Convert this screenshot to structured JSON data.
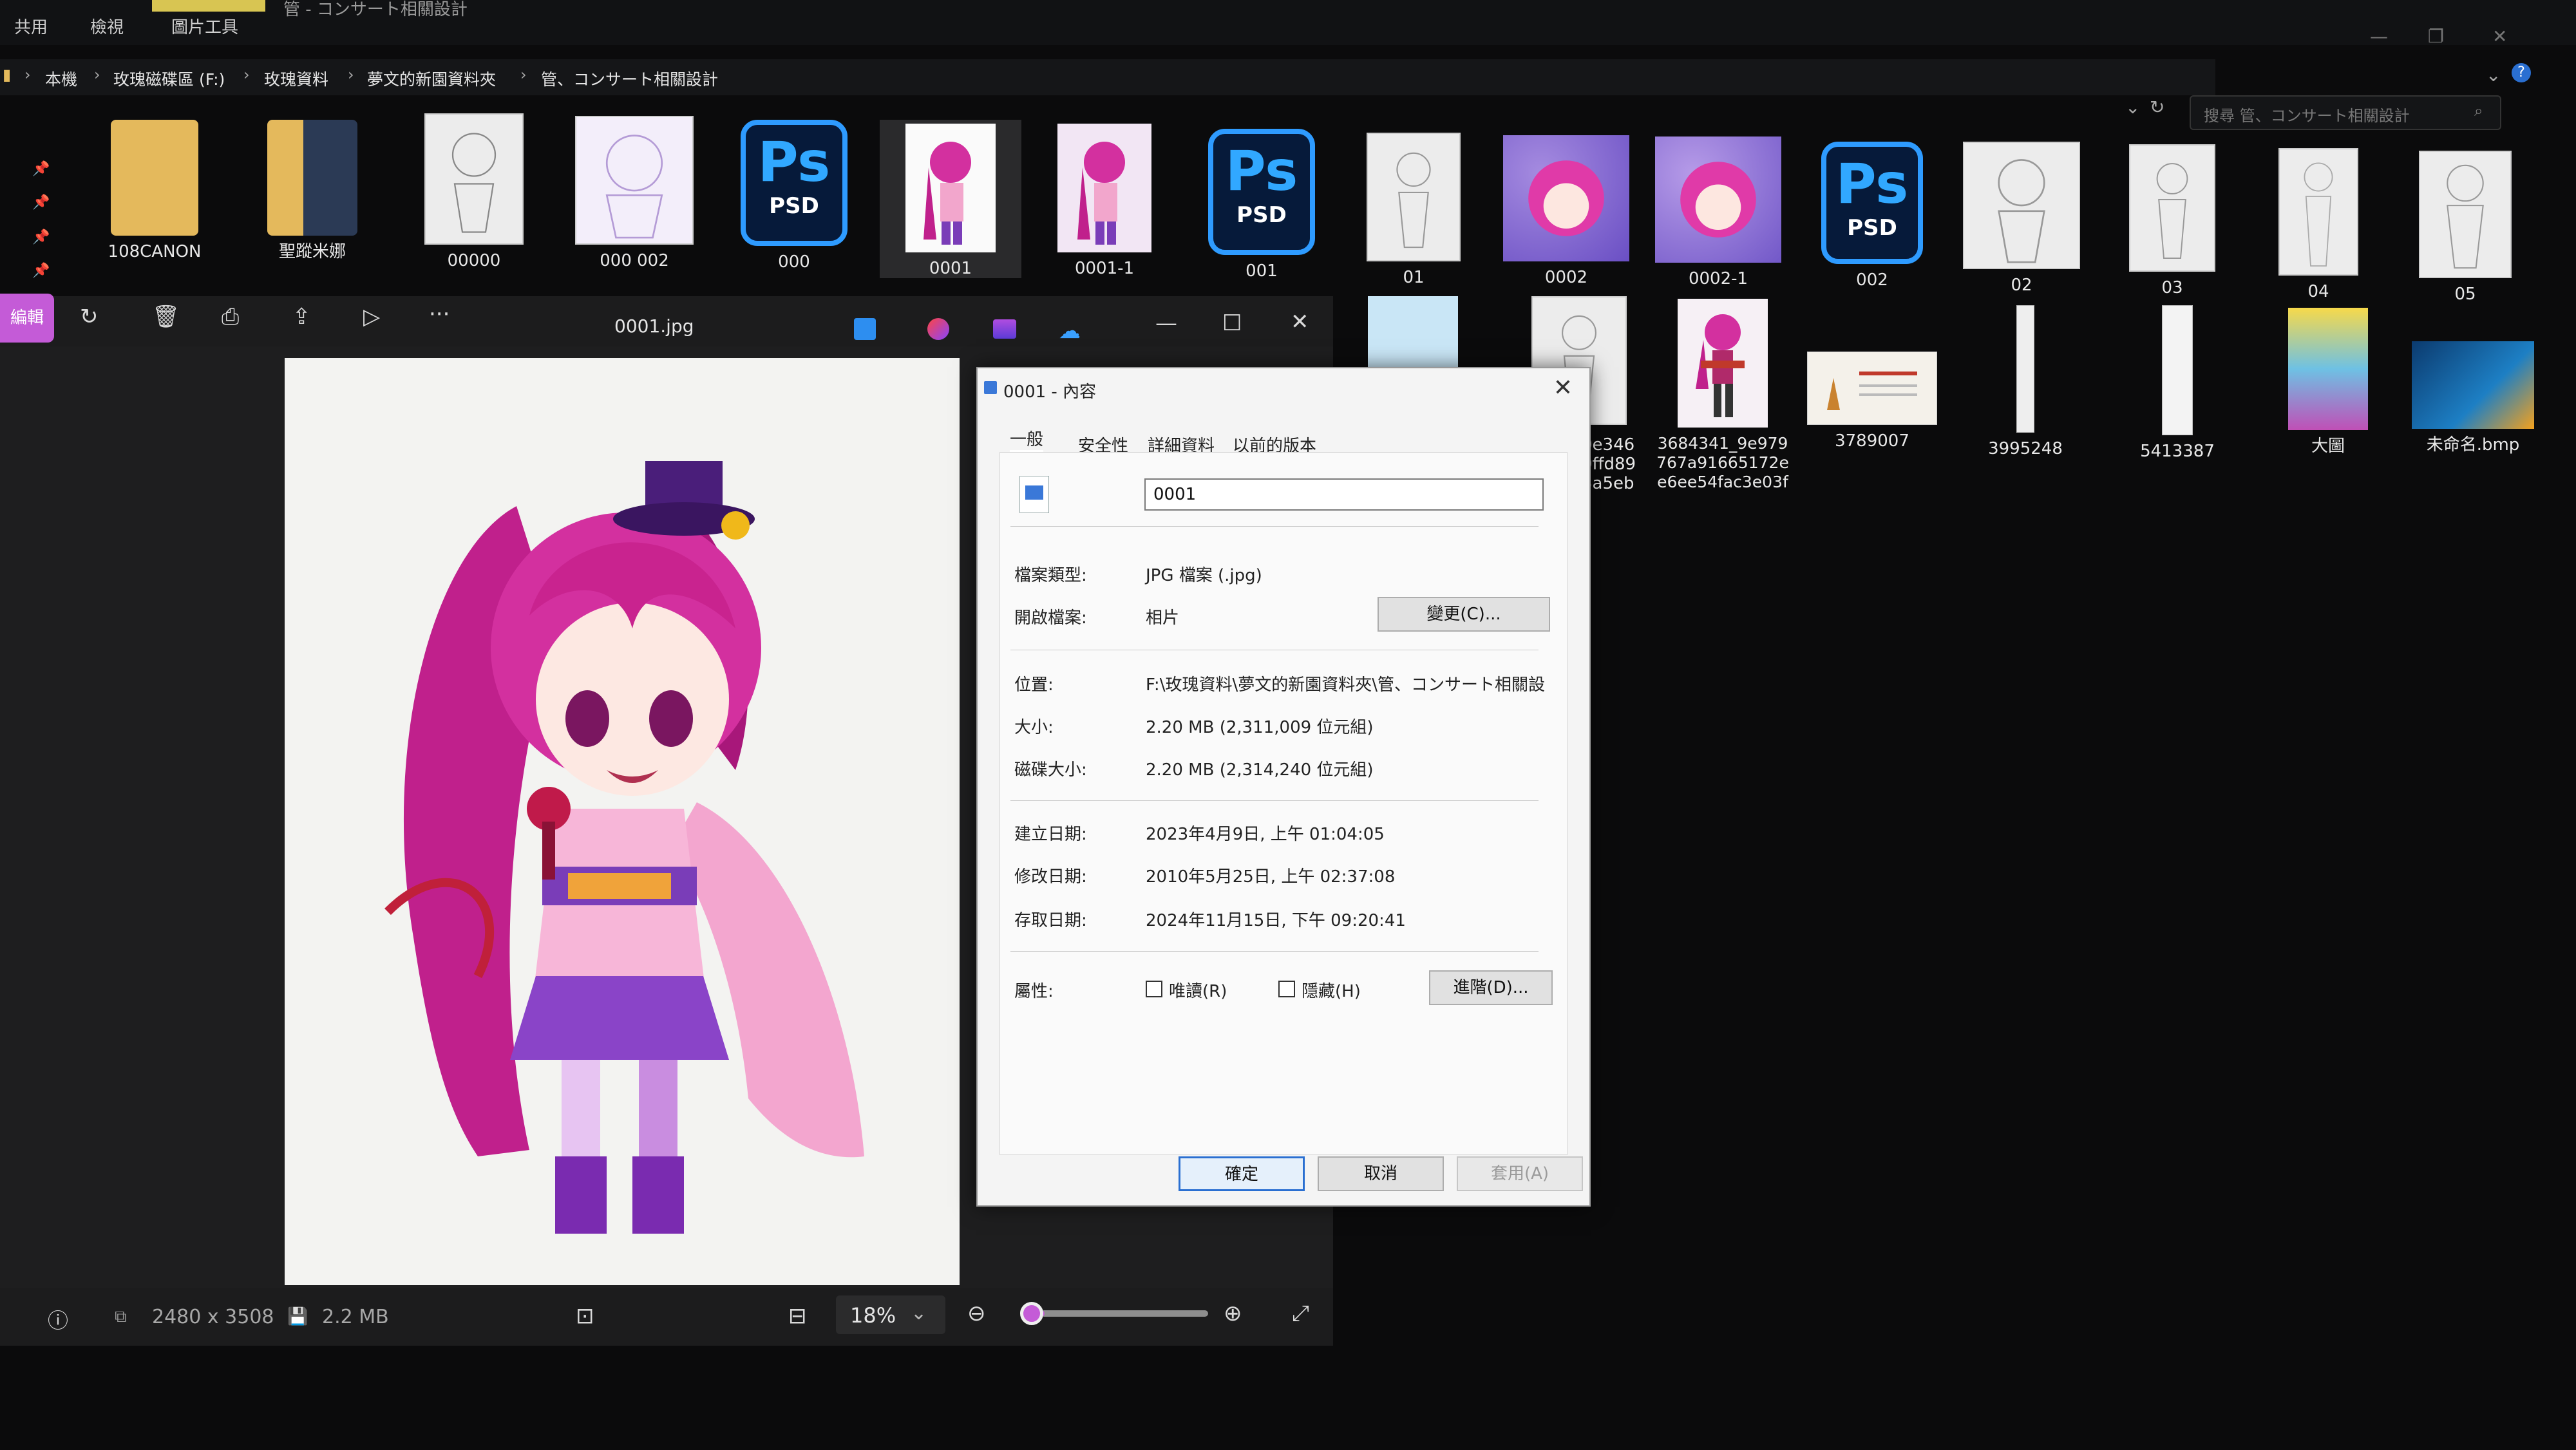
{
  "ribbon": {
    "tabs": [
      "共用",
      "檢視",
      "圖片工具"
    ],
    "context_label": "管"
  },
  "window_title": "管 - コンサート相關設計",
  "breadcrumb": [
    "本機",
    "玫瑰磁碟區 (F:)",
    "玫瑰資料",
    "夢文的新園資料夾",
    "管、コンサート相關設計"
  ],
  "search": {
    "placeholder": "搜尋 管、コンサート相關設計"
  },
  "thumbnails_row1": [
    {
      "label": "108CANON",
      "kind": "folder"
    },
    {
      "label": "聖蹤米娜",
      "kind": "folder-psd"
    },
    {
      "label": "00000",
      "kind": "sketch"
    },
    {
      "label": "000 002",
      "kind": "sketch-purple"
    },
    {
      "label": "000",
      "kind": "psd"
    },
    {
      "label": "0001",
      "kind": "pink"
    },
    {
      "label": "0001-1",
      "kind": "pink"
    },
    {
      "label": "001",
      "kind": "psd"
    },
    {
      "label": "01",
      "kind": "sketch"
    },
    {
      "label": "0002",
      "kind": "pink-face"
    },
    {
      "label": "0002-1",
      "kind": "pink-face"
    },
    {
      "label": "002",
      "kind": "psd"
    },
    {
      "label": "02",
      "kind": "sketch"
    },
    {
      "label": "03",
      "kind": "sketch"
    },
    {
      "label": "04",
      "kind": "sketch"
    },
    {
      "label": "05",
      "kind": "sketch"
    }
  ],
  "thumbnails_row2": [
    {
      "label": "0e346 0ffd89 3a5eb",
      "kind": "sketch"
    },
    {
      "label": "3684341_9e979 767a91665172e e6ee54fac3e03f",
      "kind": "pink-guitar"
    },
    {
      "label": "3789007",
      "kind": "guitar-doc"
    },
    {
      "label": "3995248",
      "kind": "strip"
    },
    {
      "label": "5413387",
      "kind": "strip"
    },
    {
      "label": "大圖",
      "kind": "poster"
    },
    {
      "label": "未命名.bmp",
      "kind": "bmp"
    }
  ],
  "psd_icon": {
    "ps": "Ps",
    "ft": "PSD"
  },
  "viewer": {
    "edit_label": "編輯",
    "filename": "0001.jpg",
    "dimensions": "2480 x 3508",
    "filesize": "2.2 MB",
    "zoom": "18%",
    "zoom_fraction": 0.04
  },
  "dialog": {
    "title": "0001 - 內容",
    "tabs": [
      "一般",
      "安全性",
      "詳細資料",
      "以前的版本"
    ],
    "filename": "0001",
    "rows": [
      {
        "label": "檔案類型:",
        "value": "JPG 檔案 (.jpg)"
      },
      {
        "label": "開啟檔案:",
        "value": "相片"
      },
      {
        "label": "位置:",
        "value": "F:\\玫瑰資料\\夢文的新園資料夾\\管、コンサート相關設"
      },
      {
        "label": "大小:",
        "value": "2.20 MB (2,311,009 位元組)"
      },
      {
        "label": "磁碟大小:",
        "value": "2.20 MB (2,314,240 位元組)"
      },
      {
        "label": "建立日期:",
        "value": "2023年4月9日, 上午 01:04:05"
      },
      {
        "label": "修改日期:",
        "value": "2010年5月25日, 上午 02:37:08"
      },
      {
        "label": "存取日期:",
        "value": "2024年11月15日, 下午 09:20:41"
      }
    ],
    "change_button": "變更(C)...",
    "attributes_label": "屬性:",
    "readonly_label": "唯讀(R)",
    "hidden_label": "隱藏(H)",
    "advanced_button": "進階(D)...",
    "ok_button": "確定",
    "cancel_button": "取消",
    "apply_button": "套用(A)"
  }
}
